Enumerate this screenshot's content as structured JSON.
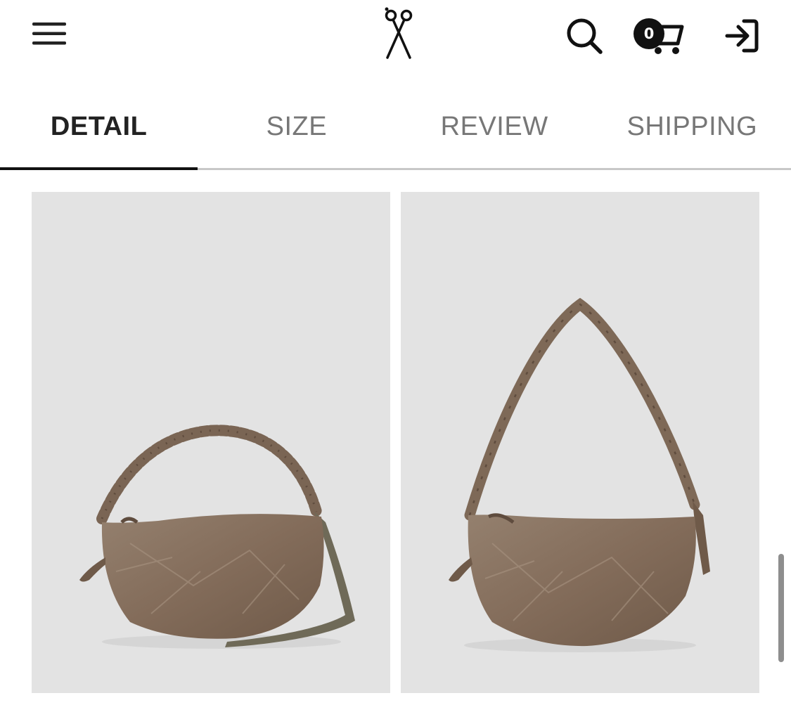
{
  "header": {
    "menu_icon": "hamburger-menu-icon",
    "logo_icon": "scissors-logo-icon",
    "search_icon": "search-icon",
    "cart_icon": "shopping-cart-icon",
    "cart_count": "0",
    "login_icon": "login-arrow-icon"
  },
  "tabs": [
    {
      "label": "DETAIL",
      "active": true
    },
    {
      "label": "SIZE",
      "active": false
    },
    {
      "label": "REVIEW",
      "active": false
    },
    {
      "label": "SHIPPING",
      "active": false
    }
  ],
  "gallery": {
    "images": [
      {
        "subject": "brown crinkled leather hobo bag with ruched handle and strap"
      },
      {
        "subject": "brown crinkled leather hobo bag with long shoulder strap"
      }
    ]
  },
  "colors": {
    "bag_brown": "#8a7260",
    "photo_background": "#e3e3e3",
    "active_tab_underline": "#111111"
  }
}
